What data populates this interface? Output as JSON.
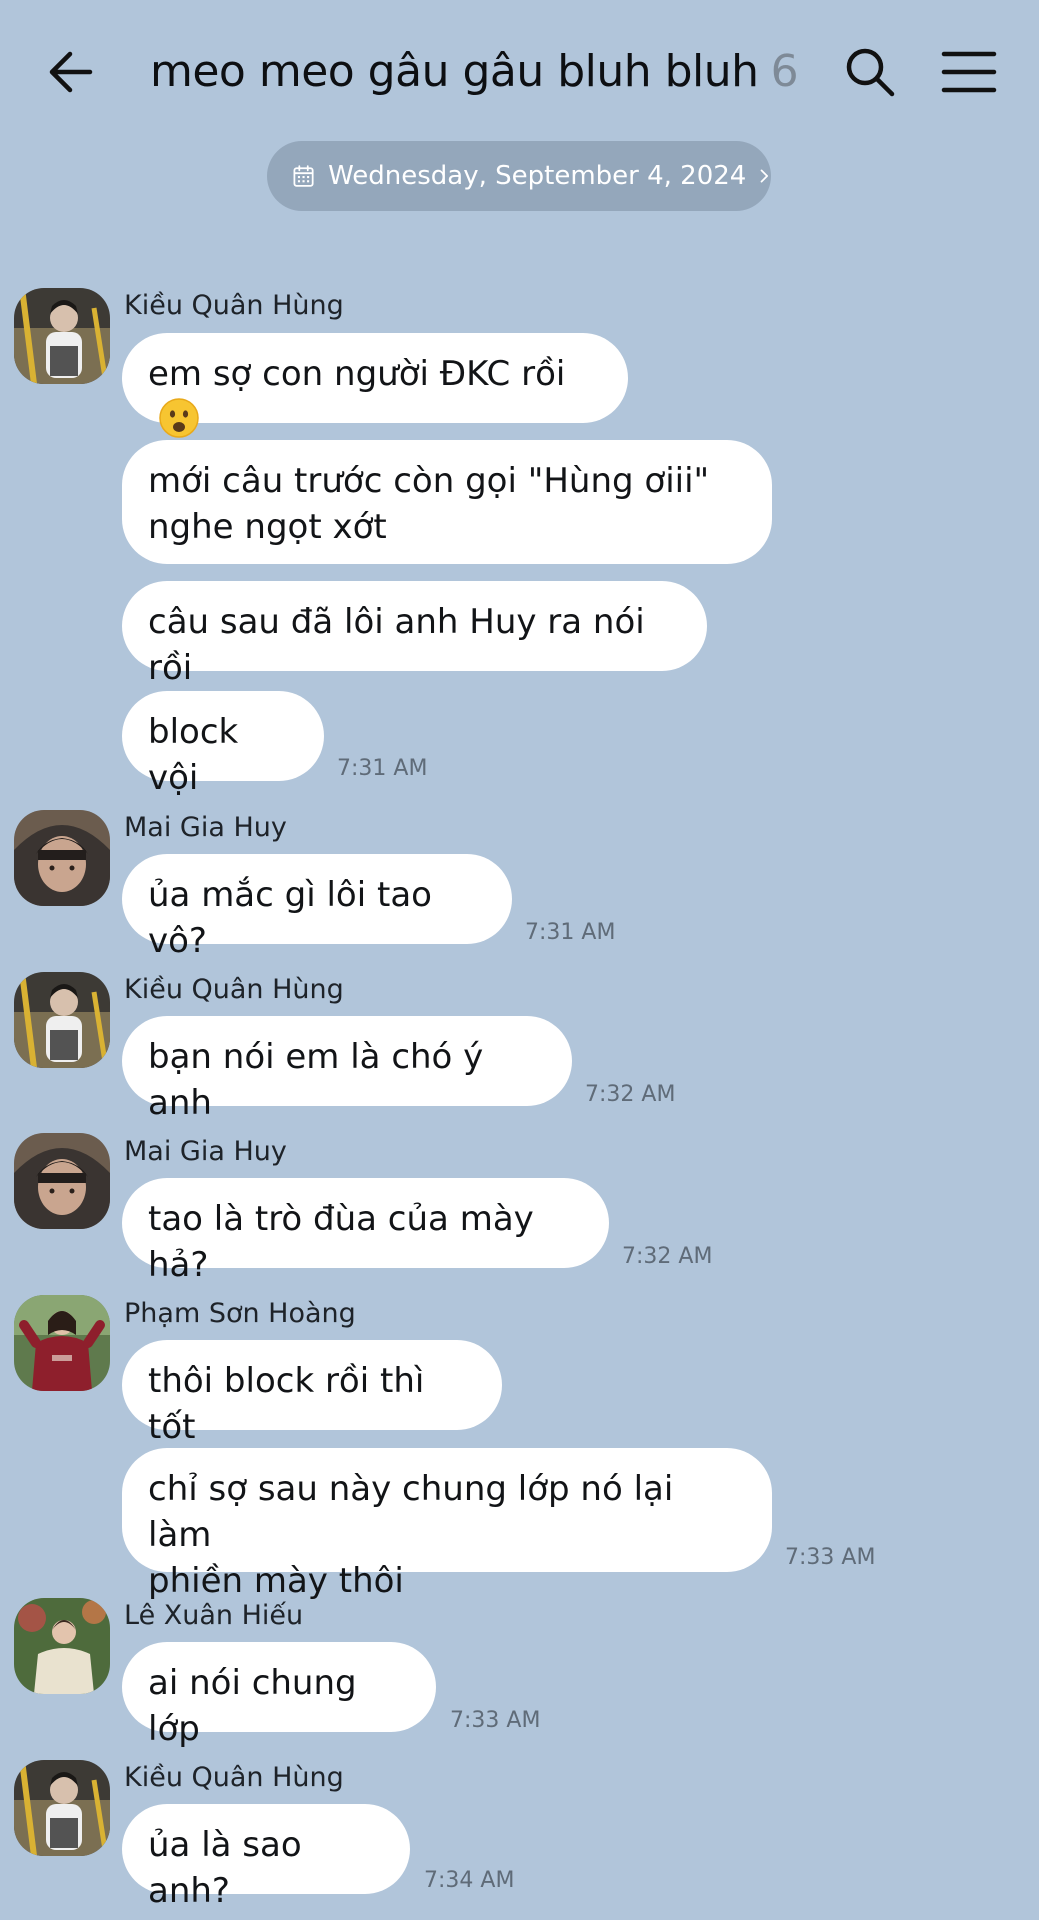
{
  "header": {
    "title": "meo meo gâu gâu bluh bluh",
    "member_count": "6"
  },
  "date_divider": "Wednesday, September 4, 2024",
  "senders": {
    "hung": "Kiều Quân Hùng",
    "huy": "Mai Gia Huy",
    "hoang": "Phạm Sơn Hoàng",
    "hieu": "Lê Xuân Hiếu"
  },
  "messages": [
    {
      "text": "em sợ con người ĐKC rồi",
      "emoji": "frowning-face-emoji"
    },
    {
      "text_line1": "mới câu trước còn gọi \"Hùng ơiii\"",
      "text_line2": "nghe ngọt xớt"
    },
    {
      "text": "câu sau đã lôi anh Huy ra nói rồi"
    },
    {
      "text": "block vội",
      "time": "7:31 AM"
    },
    {
      "text": "ủa mắc gì lôi tao vô?",
      "time": "7:31 AM"
    },
    {
      "text": "bạn nói em là chó ý anh",
      "time": "7:32 AM"
    },
    {
      "text": "tao là trò đùa của mày hả?",
      "time": "7:32 AM"
    },
    {
      "text": "thôi block rồi thì tốt"
    },
    {
      "text_line1": "chỉ sợ sau này chung lớp nó lại làm",
      "text_line2": "phiền mày thôi",
      "time": "7:33 AM"
    },
    {
      "text": "ai nói chung lớp",
      "time": "7:33 AM"
    },
    {
      "text": "ủa là sao anh?",
      "time": "7:34 AM"
    }
  ],
  "icons": {
    "back": "arrow-left-icon",
    "search": "search-icon",
    "menu": "hamburger-menu-icon",
    "calendar": "calendar-icon",
    "chevron": "chevron-right-icon"
  },
  "colors": {
    "background": "#b1c5da",
    "bubble": "#ffffff",
    "date_pill": "#94a7bb"
  }
}
